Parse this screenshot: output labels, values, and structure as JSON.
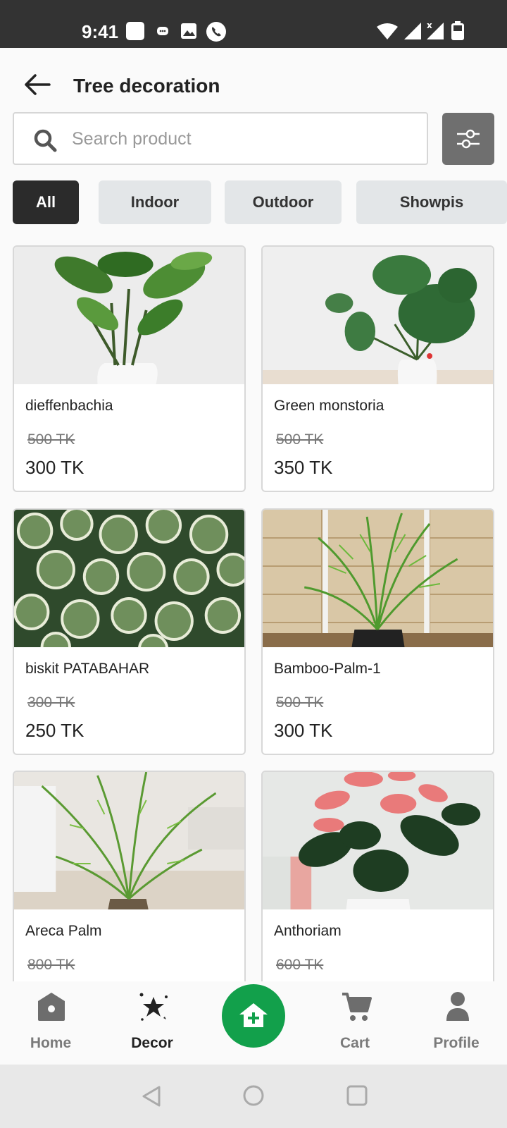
{
  "status_bar": {
    "time": "9:41",
    "icons": [
      "square-icon",
      "message-icon",
      "image-icon",
      "phone-icon",
      "wifi-icon",
      "signal-icon",
      "signal-x-icon",
      "battery-icon"
    ]
  },
  "header": {
    "title": "Tree decoration"
  },
  "search": {
    "placeholder": "Search product",
    "value": ""
  },
  "filters": {
    "chips": [
      {
        "label": "All",
        "active": true
      },
      {
        "label": "Indoor",
        "active": false
      },
      {
        "label": "Outdoor",
        "active": false
      },
      {
        "label": "Showpis",
        "active": false
      }
    ]
  },
  "products": [
    {
      "name": "dieffenbachia",
      "old_price": "500  TK",
      "price": "300  TK"
    },
    {
      "name": "Green monstoria",
      "old_price": "500  TK",
      "price": "350  TK"
    },
    {
      "name": "biskit PATABAHAR",
      "old_price": "300  TK",
      "price": "250  TK"
    },
    {
      "name": "Bamboo-Palm-1",
      "old_price": "500  TK",
      "price": "300  TK"
    },
    {
      "name": "Areca Palm",
      "old_price": "800  TK",
      "price": ""
    },
    {
      "name": "Anthoriam",
      "old_price": "600  TK",
      "price": ""
    }
  ],
  "bottom_nav": {
    "items": [
      {
        "label": "Home",
        "icon": "home-icon",
        "active": false
      },
      {
        "label": "Decor",
        "icon": "decor-stars-icon",
        "active": true
      },
      {
        "label": "Cart",
        "icon": "cart-icon",
        "active": false
      },
      {
        "label": "Profile",
        "icon": "profile-icon",
        "active": false
      }
    ],
    "fab_icon": "add-home-icon"
  },
  "colors": {
    "status_bar": "#333333",
    "chip_active": "#2b2b2b",
    "chip_inactive": "#e3e6e8",
    "filter_button": "#6f6f6f",
    "fab": "#12a04b"
  }
}
